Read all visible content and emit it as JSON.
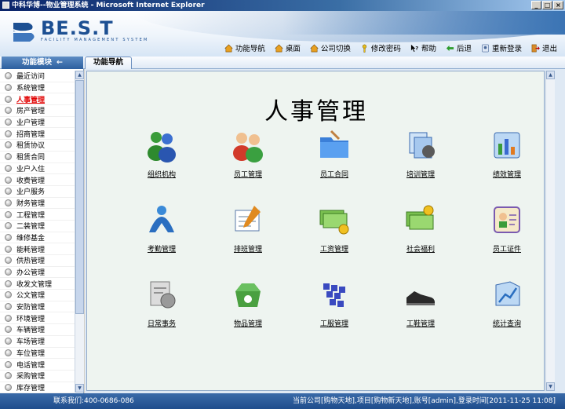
{
  "window": {
    "title": "中科华博--物业管理系统 - Microsoft Internet Explorer"
  },
  "brand": {
    "name": "BE.S.T",
    "tagline": "FACILITY MANAGEMENT SYSTEM"
  },
  "toolbar": [
    {
      "label": "功能导航",
      "icon": "home-icon"
    },
    {
      "label": "桌面",
      "icon": "desktop-icon"
    },
    {
      "label": "公司切换",
      "icon": "switch-company-icon"
    },
    {
      "label": "修改密码",
      "icon": "key-icon"
    },
    {
      "label": "帮助",
      "icon": "help-icon"
    },
    {
      "label": "后退",
      "icon": "back-icon"
    },
    {
      "label": "重新登录",
      "icon": "relogin-icon"
    },
    {
      "label": "退出",
      "icon": "exit-icon"
    }
  ],
  "sidebar": {
    "header": "功能模块",
    "arrow": "←",
    "items": [
      "最近访问",
      "系统管理",
      "人事管理",
      "房产管理",
      "业户管理",
      "招商管理",
      "租赁协议",
      "租赁合同",
      "业户入住",
      "收费管理",
      "业户服务",
      "财务管理",
      "工程管理",
      "二装管理",
      "维修基金",
      "能耗管理",
      "供热管理",
      "办公管理",
      "收发文管理",
      "公文管理",
      "安防管理",
      "环境管理",
      "车辆管理",
      "车场管理",
      "车位管理",
      "电话管理",
      "采购管理",
      "库存管理"
    ],
    "active_index": 2
  },
  "tab": {
    "label": "功能导航"
  },
  "main": {
    "title": "人事管理",
    "modules": [
      {
        "label": "组织机构",
        "icon": "organization-icon"
      },
      {
        "label": "员工管理",
        "icon": "employee-icon"
      },
      {
        "label": "员工合同",
        "icon": "contract-folder-icon"
      },
      {
        "label": "培训管理",
        "icon": "training-icon"
      },
      {
        "label": "绩效管理",
        "icon": "performance-icon"
      },
      {
        "label": "考勤管理",
        "icon": "attendance-icon"
      },
      {
        "label": "排班管理",
        "icon": "schedule-icon"
      },
      {
        "label": "工资管理",
        "icon": "salary-icon"
      },
      {
        "label": "社会福利",
        "icon": "welfare-icon"
      },
      {
        "label": "员工证件",
        "icon": "id-card-icon"
      },
      {
        "label": "日常事务",
        "icon": "daily-affairs-icon"
      },
      {
        "label": "物品管理",
        "icon": "goods-icon"
      },
      {
        "label": "工服管理",
        "icon": "uniform-icon"
      },
      {
        "label": "工鞋管理",
        "icon": "shoes-icon"
      },
      {
        "label": "统计查询",
        "icon": "statistics-icon"
      }
    ]
  },
  "status": {
    "contact": "联系我们:400-0686-086",
    "info": "当前公司[购物天地],项目[购物新天地],账号[admin],登录时间[2011-11-25 11:08]"
  },
  "colors": {
    "accent": "#2c5f9e",
    "active": "#e00000",
    "panel": "#eef4f0"
  }
}
